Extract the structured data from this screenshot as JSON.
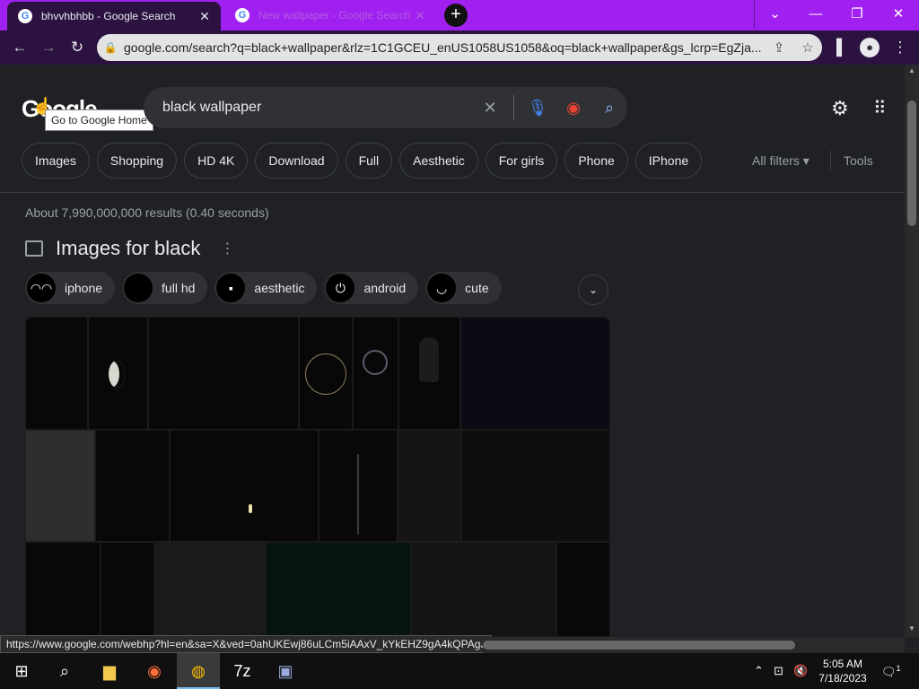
{
  "browser": {
    "tabs": [
      {
        "title": "bhvvhbhbb - Google Search",
        "active": true
      },
      {
        "title": "New wallpaper - Google Search",
        "active": false
      }
    ],
    "url": "google.com/search?q=black+wallpaper&rlz=1C1GCEU_enUS1058US1058&oq=black+wallpaper&gs_lcrp=EgZja...",
    "accent": "#a020f0"
  },
  "header": {
    "logo": "Google",
    "logo_tooltip": "Go to Google Home",
    "query": "black wallpaper"
  },
  "filters": {
    "chips": [
      "Images",
      "Shopping",
      "HD 4K",
      "Download",
      "Full",
      "Aesthetic",
      "For girls",
      "Phone",
      "IPhone"
    ],
    "all_filters": "All filters",
    "tools": "Tools"
  },
  "results": {
    "stats": "About 7,990,000,000 results (0.40 seconds)"
  },
  "images_section": {
    "title": "Images for black",
    "refinements": [
      "iphone",
      "full hd",
      "aesthetic",
      "android",
      "cute"
    ]
  },
  "status_bar": {
    "link": "https://www.google.com/webhp?hl=en&sa=X&ved=0ahUKEwj86uLCm5iAAxV_kYkEHZ9gA4kQPAgJ"
  },
  "taskbar": {
    "time": "5:05 AM",
    "date": "7/18/2023",
    "notification_count": "1"
  }
}
